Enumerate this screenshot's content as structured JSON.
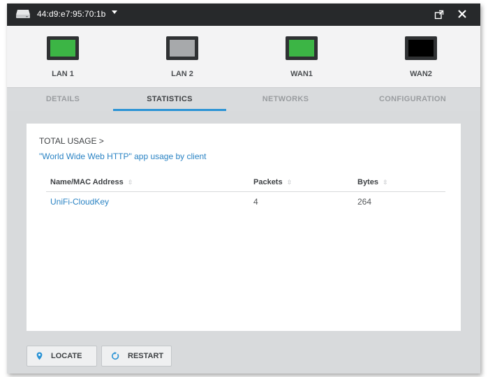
{
  "titlebar": {
    "device_label": "44:d9:e7:95:70:1b",
    "device_icon": "device-icon",
    "popout_icon": "popout-icon",
    "close_icon": "close-icon"
  },
  "ports": [
    {
      "label": "LAN 1",
      "status_color": "#3cb545"
    },
    {
      "label": "LAN 2",
      "status_color": "#a7a9ab"
    },
    {
      "label": "WAN1",
      "status_color": "#3cb545"
    },
    {
      "label": "WAN2",
      "status_color": "#000000"
    }
  ],
  "tabs": [
    {
      "label": "DETAILS",
      "active": false
    },
    {
      "label": "STATISTICS",
      "active": true
    },
    {
      "label": "NETWORKS",
      "active": false
    },
    {
      "label": "CONFIGURATION",
      "active": false
    }
  ],
  "statistics": {
    "breadcrumb": "TOTAL USAGE >",
    "subtitle": "\"World Wide Web HTTP\" app usage by client",
    "columns": [
      "Name/MAC Address",
      "Packets",
      "Bytes"
    ],
    "rows": [
      {
        "name": "UniFi-CloudKey",
        "packets": "4",
        "bytes": "264"
      }
    ]
  },
  "actions": {
    "locate_label": "LOCATE",
    "locate_icon": "location-pin-icon",
    "restart_label": "RESTART",
    "restart_icon": "restart-icon"
  },
  "colors": {
    "accent": "#2a93d5",
    "link": "#2a83c4",
    "titlebar": "#27292b"
  }
}
